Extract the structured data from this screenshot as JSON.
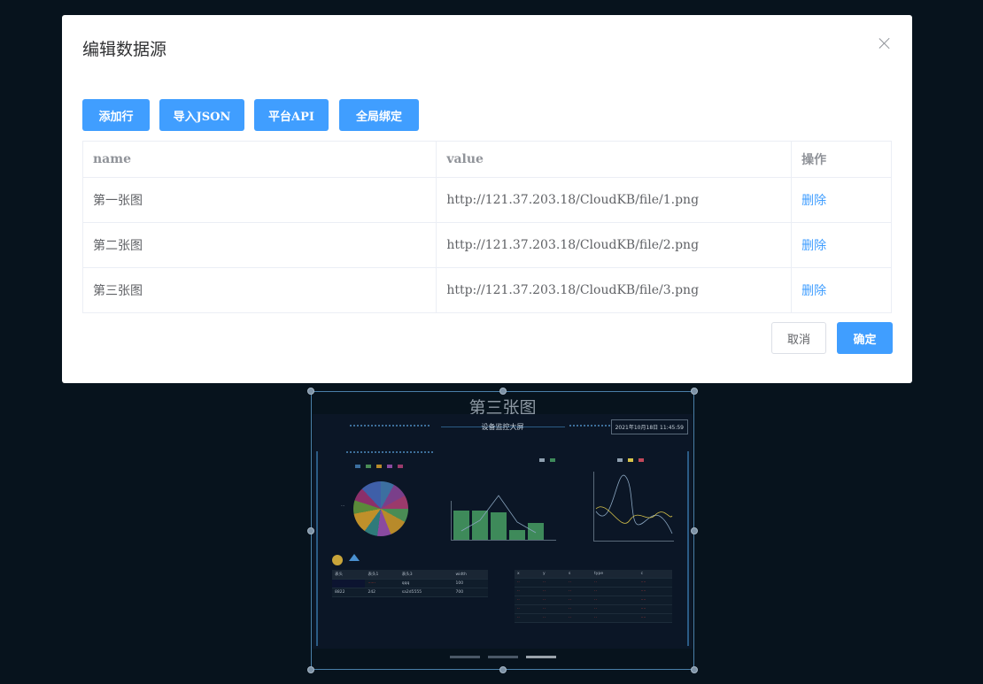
{
  "modal": {
    "title": "编辑数据源",
    "toolbar": {
      "add_row": "添加行",
      "import_json": "导入JSON",
      "platform_api": "平台API",
      "global_bind": "全局绑定"
    },
    "table": {
      "headers": {
        "name": "name",
        "value": "value",
        "actions": "操作"
      },
      "rows": [
        {
          "name": "第一张图",
          "value": "http://121.37.203.18/CloudKB/file/1.png",
          "action": "删除"
        },
        {
          "name": "第二张图",
          "value": "http://121.37.203.18/CloudKB/file/2.png",
          "action": "删除"
        },
        {
          "name": "第三张图",
          "value": "http://121.37.203.18/CloudKB/file/3.png",
          "action": "删除"
        }
      ]
    },
    "footer": {
      "cancel": "取消",
      "confirm": "确定"
    }
  },
  "component": {
    "title": "第三张图",
    "screenshot": {
      "title": "设备监控大屏",
      "time": "2021年10月18日 11:45:59"
    }
  },
  "colors": {
    "primary": "#409eff",
    "page_background": "#07131d",
    "selection_border": "#4a7fa8"
  }
}
